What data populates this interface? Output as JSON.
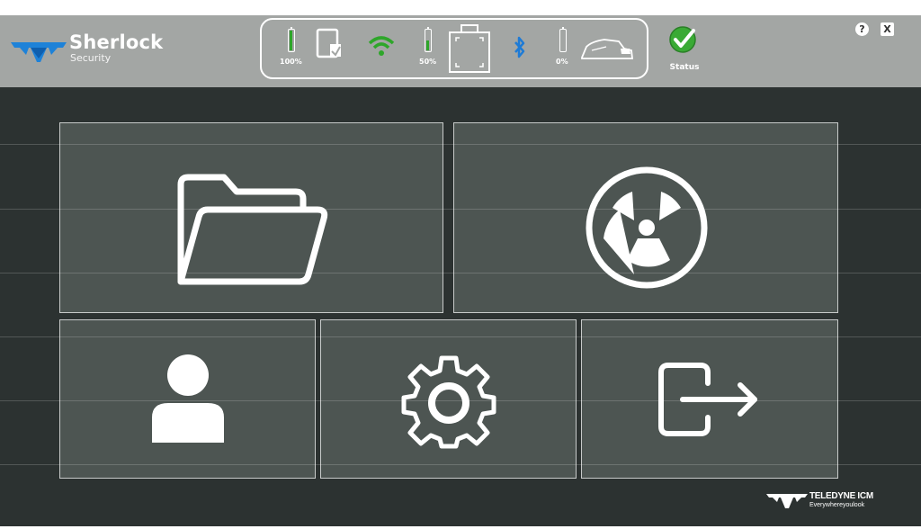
{
  "app": {
    "name": "Sherlock",
    "subtitle": "Security"
  },
  "status_bar": {
    "device_battery": {
      "percent_label": "100%",
      "level": 1.0
    },
    "tablet_icon": "tablet-docked-icon",
    "wifi_icon": "wifi-icon",
    "wifi_color": "#2ea62a",
    "sensor_battery": {
      "percent_label": "50%",
      "level": 0.5
    },
    "sensor_icon": "sensor-module-icon",
    "bluetooth_icon": "bluetooth-icon",
    "bluetooth_color": "#1e7bd6",
    "vehicle_battery": {
      "percent_label": "0%",
      "level": 0.0
    },
    "vehicle_icon": "vehicle-icon",
    "status_label": "Status",
    "status_color": "#3aaa35"
  },
  "window_controls": {
    "help_label": "?",
    "close_label": "X"
  },
  "tiles": [
    {
      "id": "files",
      "icon": "folder-icon"
    },
    {
      "id": "radiation",
      "icon": "radiation-icon"
    },
    {
      "id": "user",
      "icon": "user-icon"
    },
    {
      "id": "settings",
      "icon": "gear-icon"
    },
    {
      "id": "exit",
      "icon": "exit-icon"
    }
  ],
  "footer": {
    "brand": "TELEDYNE ICM",
    "tagline": "Everywhereyoulook"
  },
  "colors": {
    "header_bg": "#a3a6a4",
    "main_bg": "#2c3231",
    "tile_bg": "#4d5552",
    "tile_border": "#c8cbca"
  }
}
